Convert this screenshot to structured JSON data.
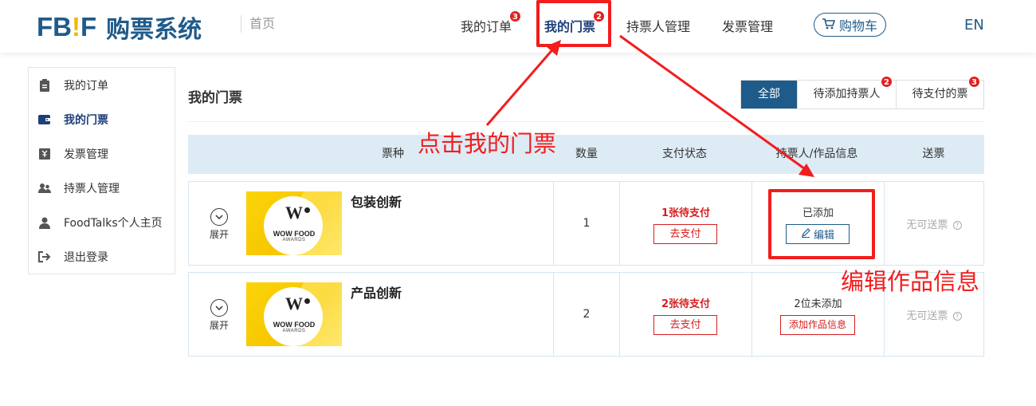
{
  "header": {
    "logo_prefix": "FB",
    "logo_bang": "!",
    "logo_suffix": "F",
    "logo_cn": "购票系统",
    "home": "首页",
    "nav": [
      {
        "label": "我的订单",
        "badge": "3"
      },
      {
        "label": "我的门票",
        "badge": "2"
      },
      {
        "label": "持票人管理",
        "badge": ""
      },
      {
        "label": "发票管理",
        "badge": ""
      }
    ],
    "cart": "购物车",
    "lang": "EN"
  },
  "sidebar": {
    "items": [
      {
        "label": "我的订单",
        "icon": "clipboard-icon"
      },
      {
        "label": "我的门票",
        "icon": "wallet-icon"
      },
      {
        "label": "发票管理",
        "icon": "invoice-icon"
      },
      {
        "label": "持票人管理",
        "icon": "users-icon"
      },
      {
        "label": "FoodTalks个人主页",
        "icon": "user-icon"
      },
      {
        "label": "退出登录",
        "icon": "logout-icon"
      }
    ]
  },
  "main": {
    "title": "我的门票",
    "tabs": [
      {
        "label": "全部",
        "badge": ""
      },
      {
        "label": "待添加持票人",
        "badge": "2"
      },
      {
        "label": "待支付的票",
        "badge": "3"
      }
    ],
    "columns": [
      "票种",
      "数量",
      "支付状态",
      "持票人/作品信息",
      "送票"
    ],
    "rows": [
      {
        "expand": "展开",
        "image_title": "WOW FOOD",
        "image_sub": "AWARDS",
        "image_logo": "W",
        "name": "包装创新",
        "qty": "1",
        "pay_status": "1张待支付",
        "pay_button": "去支付",
        "holder_status": "已添加",
        "holder_button": "编辑",
        "gift": "无可送票"
      },
      {
        "expand": "展开",
        "image_title": "WOW FOOD",
        "image_sub": "AWARDS",
        "image_logo": "W",
        "name": "产品创新",
        "qty": "2",
        "pay_status": "2张待支付",
        "pay_button": "去支付",
        "holder_status": "2位未添加",
        "holder_button": "添加作品信息",
        "gift": "无可送票"
      }
    ]
  },
  "annotations": {
    "click_tickets": "点击我的门票",
    "edit_info": "编辑作品信息"
  },
  "colors": {
    "brand": "#1f5b8a",
    "accent": "#f2b705",
    "alert": "#d71e1e",
    "annotation": "#f21d1d"
  }
}
